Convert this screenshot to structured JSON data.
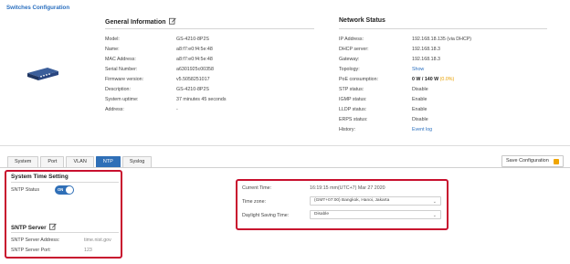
{
  "page": {
    "title": "Switches Configuration"
  },
  "general_info": {
    "title": "General Information",
    "rows": [
      {
        "key": "Model:",
        "value": "GS-4210-8P2S"
      },
      {
        "key": "Name:",
        "value": "a8:f7:e0:f4:5e:48"
      },
      {
        "key": "MAC Address:",
        "value": "a8:f7:e0:f4:5e:48"
      },
      {
        "key": "Serial Number:",
        "value": "a6301925c00358"
      },
      {
        "key": "Firmware version:",
        "value": "v5.5058251017"
      },
      {
        "key": "Description:",
        "value": "GS-4210-8P2S"
      },
      {
        "key": "System uptime:",
        "value": "37 minutes 45 seconds"
      },
      {
        "key": "Address:",
        "value": "-"
      }
    ]
  },
  "network_status": {
    "title": "Network Status",
    "rows": [
      {
        "key": "IP Address:",
        "value": "192.168.18.135 (via DHCP)"
      },
      {
        "key": "DHCP server:",
        "value": "192.168.18.3"
      },
      {
        "key": "Gateway:",
        "value": "192.168.18.3"
      },
      {
        "key": "Topology:",
        "value": "Show"
      },
      {
        "key": "PoE consumption:",
        "value": "0 W / 140 W",
        "extra": "(0.0%)"
      },
      {
        "key": "STP status:",
        "value": "Disable"
      },
      {
        "key": "IGMP status:",
        "value": "Enable"
      },
      {
        "key": "LLDP status:",
        "value": "Enable"
      },
      {
        "key": "ERPS status:",
        "value": "Disable"
      },
      {
        "key": "History:",
        "value": "Event log"
      }
    ]
  },
  "tabs": [
    "System",
    "Port",
    "VLAN",
    "NTP",
    "Syslog"
  ],
  "active_tab": "NTP",
  "save_button": "Save Configuration",
  "system_time": {
    "title": "System Time Setting",
    "sntp_status_label": "SNTP Status",
    "toggle_text": "ON"
  },
  "sntp_server": {
    "title": "SNTP Server",
    "address_label": "SNTP Server Address:",
    "address_value": "time.nist.gov",
    "port_label": "SNTP Server Port:",
    "port_value": "123"
  },
  "time_panel": {
    "current_time_label": "Current Time:",
    "current_time_value": "16:19:15 mm(UTC+7) Mar 27 2020",
    "time_zone_label": "Time zone:",
    "time_zone_value": "(GMT+07:00) Bangkok, Hanoi, Jakarta",
    "dst_label": "Daylight Saving Time:",
    "dst_value": "Disable"
  },
  "colors": {
    "accent": "#2f6fb7",
    "link": "#2a6fbf",
    "highlight": "#c8102e",
    "poe": "#e8a000"
  }
}
